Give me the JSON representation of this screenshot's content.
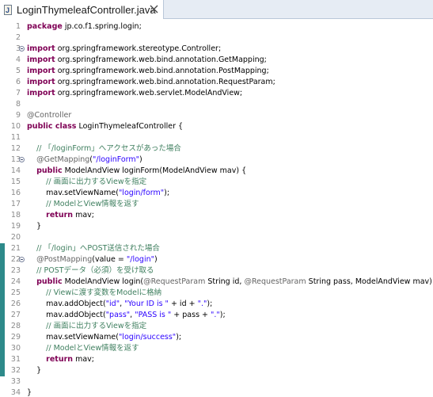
{
  "tab": {
    "title": "LoginThymeleafController.java",
    "icon": "java-file-icon"
  },
  "colors": {
    "keyword": "#7f0055",
    "comment": "#3f7f5f",
    "string": "#2a00ff",
    "annotation": "#646464",
    "change_marker": "#2d8a8a"
  },
  "lines": [
    {
      "n": "1",
      "tokens": [
        {
          "t": "k",
          "v": "package"
        },
        {
          "t": "p",
          "v": " jp.co.f1.spring.login;"
        }
      ]
    },
    {
      "n": "2",
      "tokens": []
    },
    {
      "n": "3",
      "fold": true,
      "tokens": [
        {
          "t": "k",
          "v": "import"
        },
        {
          "t": "p",
          "v": " org.springframework.stereotype.Controller;"
        }
      ]
    },
    {
      "n": "4",
      "tokens": [
        {
          "t": "k",
          "v": "import"
        },
        {
          "t": "p",
          "v": " org.springframework.web.bind.annotation.GetMapping;"
        }
      ]
    },
    {
      "n": "5",
      "tokens": [
        {
          "t": "k",
          "v": "import"
        },
        {
          "t": "p",
          "v": " org.springframework.web.bind.annotation.PostMapping;"
        }
      ]
    },
    {
      "n": "6",
      "tokens": [
        {
          "t": "k",
          "v": "import"
        },
        {
          "t": "p",
          "v": " org.springframework.web.bind.annotation.RequestParam;"
        }
      ]
    },
    {
      "n": "7",
      "tokens": [
        {
          "t": "k",
          "v": "import"
        },
        {
          "t": "p",
          "v": " org.springframework.web.servlet.ModelAndView;"
        }
      ]
    },
    {
      "n": "8",
      "tokens": []
    },
    {
      "n": "9",
      "tokens": [
        {
          "t": "a",
          "v": "@Controller"
        }
      ]
    },
    {
      "n": "10",
      "tokens": [
        {
          "t": "k",
          "v": "public class"
        },
        {
          "t": "p",
          "v": " LoginThymeleafController {"
        }
      ]
    },
    {
      "n": "11",
      "tokens": []
    },
    {
      "n": "12",
      "tokens": [
        {
          "t": "p",
          "v": "    "
        },
        {
          "t": "c",
          "v": "// 「/loginForm」へアクセスがあった場合"
        }
      ]
    },
    {
      "n": "13",
      "fold": true,
      "tokens": [
        {
          "t": "p",
          "v": "    "
        },
        {
          "t": "a",
          "v": "@GetMapping"
        },
        {
          "t": "p",
          "v": "("
        },
        {
          "t": "s",
          "v": "\"/loginForm\""
        },
        {
          "t": "p",
          "v": ")"
        }
      ]
    },
    {
      "n": "14",
      "tokens": [
        {
          "t": "p",
          "v": "    "
        },
        {
          "t": "k",
          "v": "public"
        },
        {
          "t": "p",
          "v": " ModelAndView loginForm(ModelAndView mav) {"
        }
      ]
    },
    {
      "n": "15",
      "tokens": [
        {
          "t": "p",
          "v": "        "
        },
        {
          "t": "c",
          "v": "// 画面に出力するViewを指定"
        }
      ]
    },
    {
      "n": "16",
      "tokens": [
        {
          "t": "p",
          "v": "        mav.setViewName("
        },
        {
          "t": "s",
          "v": "\"login/form\""
        },
        {
          "t": "p",
          "v": ");"
        }
      ]
    },
    {
      "n": "17",
      "tokens": [
        {
          "t": "p",
          "v": "        "
        },
        {
          "t": "c",
          "v": "// ModelとView情報を返す"
        }
      ]
    },
    {
      "n": "18",
      "tokens": [
        {
          "t": "p",
          "v": "        "
        },
        {
          "t": "k",
          "v": "return"
        },
        {
          "t": "p",
          "v": " mav;"
        }
      ]
    },
    {
      "n": "19",
      "tokens": [
        {
          "t": "p",
          "v": "    }"
        }
      ]
    },
    {
      "n": "20",
      "tokens": []
    },
    {
      "n": "21",
      "chg": true,
      "tokens": [
        {
          "t": "p",
          "v": "    "
        },
        {
          "t": "c",
          "v": "// 「/login」へPOST送信された場合"
        }
      ]
    },
    {
      "n": "22",
      "chg": true,
      "fold": true,
      "tokens": [
        {
          "t": "p",
          "v": "    "
        },
        {
          "t": "a",
          "v": "@PostMapping"
        },
        {
          "t": "p",
          "v": "(value = "
        },
        {
          "t": "s",
          "v": "\"/login\""
        },
        {
          "t": "p",
          "v": ")"
        }
      ]
    },
    {
      "n": "23",
      "chg": true,
      "tokens": [
        {
          "t": "p",
          "v": "    "
        },
        {
          "t": "c",
          "v": "// POSTデータ（必須）を受け取る"
        }
      ]
    },
    {
      "n": "24",
      "chg": true,
      "tokens": [
        {
          "t": "p",
          "v": "    "
        },
        {
          "t": "k",
          "v": "public"
        },
        {
          "t": "p",
          "v": " ModelAndView login("
        },
        {
          "t": "a",
          "v": "@RequestParam"
        },
        {
          "t": "p",
          "v": " String id, "
        },
        {
          "t": "a",
          "v": "@RequestParam"
        },
        {
          "t": "p",
          "v": " String pass, ModelAndView mav) {"
        }
      ]
    },
    {
      "n": "25",
      "chg": true,
      "tokens": [
        {
          "t": "p",
          "v": "        "
        },
        {
          "t": "c",
          "v": "// Viewに渡す変数をModelに格納"
        }
      ]
    },
    {
      "n": "26",
      "chg": true,
      "tokens": [
        {
          "t": "p",
          "v": "        mav.addObject("
        },
        {
          "t": "s",
          "v": "\"id\""
        },
        {
          "t": "p",
          "v": ", "
        },
        {
          "t": "s",
          "v": "\"Your ID is \""
        },
        {
          "t": "p",
          "v": " + id + "
        },
        {
          "t": "s",
          "v": "\".\""
        },
        {
          "t": "p",
          "v": ");"
        }
      ]
    },
    {
      "n": "27",
      "chg": true,
      "tokens": [
        {
          "t": "p",
          "v": "        mav.addObject("
        },
        {
          "t": "s",
          "v": "\"pass\""
        },
        {
          "t": "p",
          "v": ", "
        },
        {
          "t": "s",
          "v": "\"PASS is \""
        },
        {
          "t": "p",
          "v": " + pass + "
        },
        {
          "t": "s",
          "v": "\".\""
        },
        {
          "t": "p",
          "v": ");"
        }
      ]
    },
    {
      "n": "28",
      "chg": true,
      "tokens": [
        {
          "t": "p",
          "v": "        "
        },
        {
          "t": "c",
          "v": "// 画面に出力するViewを指定"
        }
      ]
    },
    {
      "n": "29",
      "chg": true,
      "tokens": [
        {
          "t": "p",
          "v": "        mav.setViewName("
        },
        {
          "t": "s",
          "v": "\"login/success\""
        },
        {
          "t": "p",
          "v": ");"
        }
      ]
    },
    {
      "n": "30",
      "chg": true,
      "tokens": [
        {
          "t": "p",
          "v": "        "
        },
        {
          "t": "c",
          "v": "// ModelとView情報を返す"
        }
      ]
    },
    {
      "n": "31",
      "chg": true,
      "tokens": [
        {
          "t": "p",
          "v": "        "
        },
        {
          "t": "k",
          "v": "return"
        },
        {
          "t": "p",
          "v": " mav;"
        }
      ]
    },
    {
      "n": "32",
      "chg": true,
      "tokens": [
        {
          "t": "p",
          "v": "    }"
        }
      ]
    },
    {
      "n": "33",
      "tokens": []
    },
    {
      "n": "34",
      "tokens": [
        {
          "t": "p",
          "v": "}"
        }
      ]
    }
  ]
}
